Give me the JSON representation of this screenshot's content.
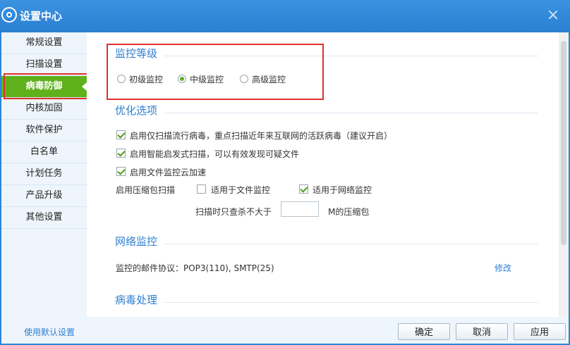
{
  "window": {
    "title": "设置中心",
    "close_label": "×"
  },
  "sidebar": {
    "items": [
      {
        "label": "常规设置"
      },
      {
        "label": "扫描设置"
      },
      {
        "label": "病毒防御"
      },
      {
        "label": "内核加固"
      },
      {
        "label": "软件保护"
      },
      {
        "label": "白名单"
      },
      {
        "label": "计划任务"
      },
      {
        "label": "产品升级"
      },
      {
        "label": "其他设置"
      }
    ],
    "active": "病毒防御"
  },
  "monitor_level": {
    "title": "监控等级",
    "options": [
      "初级监控",
      "中级监控",
      "高级监控"
    ],
    "selected": "中级监控"
  },
  "optimize": {
    "title": "优化选项",
    "options": [
      {
        "label": "启用仅扫描流行病毒，重点扫描近年来互联网的活跃病毒（建议开启）",
        "checked": true
      },
      {
        "label": "启用智能启发式扫描，可以有效发现可疑文件",
        "checked": true
      },
      {
        "label": "启用文件监控云加速",
        "checked": true
      }
    ],
    "compress_label": "启用压缩包扫描",
    "compress_options": [
      {
        "label": "适用于文件监控",
        "checked": false
      },
      {
        "label": "适用于网络监控",
        "checked": true
      }
    ],
    "size_prefix": "扫描时只查杀不大于",
    "size_value": "",
    "size_suffix": "M的压缩包"
  },
  "network": {
    "title": "网络监控",
    "protocol_text": "监控的邮件协议：POP3(110), SMTP(25)",
    "modify_link": "修改"
  },
  "virus": {
    "title": "病毒处理"
  },
  "footer": {
    "default_link": "使用默认设置",
    "ok": "确定",
    "cancel": "取消",
    "apply": "应用"
  },
  "colors": {
    "accent": "#2f86d6",
    "active_green": "#5fb11c",
    "highlight_red": "#e03030"
  }
}
